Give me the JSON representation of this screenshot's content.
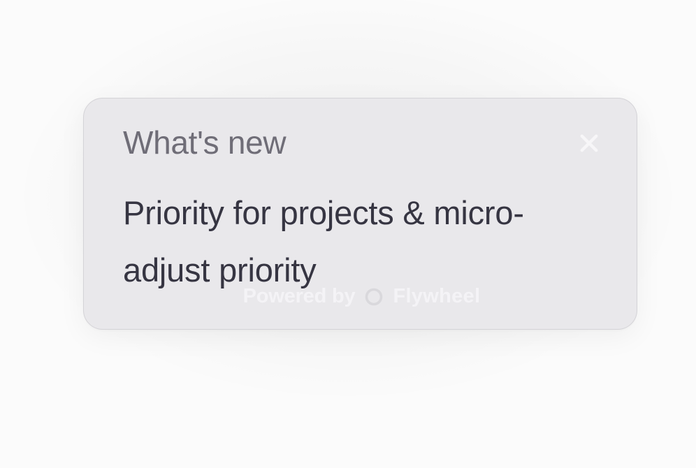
{
  "panel": {
    "heading": "What's new",
    "body": "Priority for projects & micro-adjust priority"
  },
  "footer": {
    "powered": "Powered by",
    "brand": "Flywheel"
  }
}
